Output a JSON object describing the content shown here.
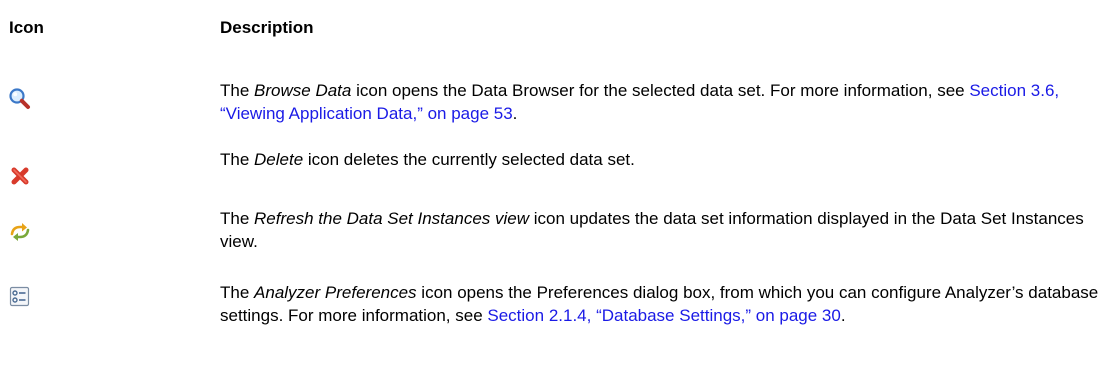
{
  "table": {
    "header": {
      "icon": "Icon",
      "description": "Description"
    },
    "rows": [
      {
        "icon": "magnifier-icon",
        "desc_pre": "The ",
        "desc_em": "Browse Data",
        "desc_mid": " icon opens the Data Browser for the selected data set. For more information, see ",
        "link": "Section 3.6, “Viewing Application Data,” on page 53",
        "desc_post": "."
      },
      {
        "icon": "delete-x-icon",
        "desc_pre": "The ",
        "desc_em": "Delete",
        "desc_mid": " icon deletes the currently selected data set."
      },
      {
        "icon": "refresh-arrows-icon",
        "desc_pre": "The ",
        "desc_em": "Refresh the Data Set Instances view",
        "desc_mid": " icon updates the data set information displayed in the Data Set Instances view."
      },
      {
        "icon": "preferences-list-icon",
        "desc_pre": "The ",
        "desc_em": "Analyzer Preferences",
        "desc_mid": " icon opens the Preferences dialog box, from which you can configure Analyzer’s database settings. For more information, see ",
        "link": "Section 2.1.4, “Database Settings,” on page 30",
        "desc_post": "."
      }
    ]
  },
  "colors": {
    "link": "#1a1ae6",
    "delete_icon": "#d83a2b",
    "refresh_icon": "#e8a317"
  }
}
